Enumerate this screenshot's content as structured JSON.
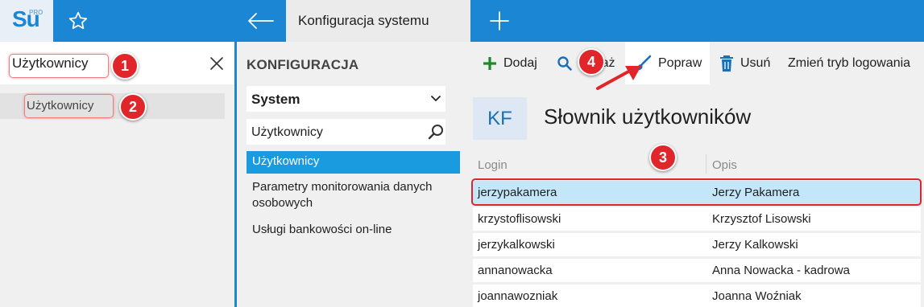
{
  "header": {
    "logo_text": "Su",
    "logo_sup": "PRO",
    "active_tab_title": "Konfiguracja systemu"
  },
  "left_search": {
    "query": "Użytkownicy",
    "results": [
      {
        "label": "Użytkownicy"
      }
    ]
  },
  "config": {
    "title": "KONFIGURACJA",
    "system_select": "System",
    "search_value": "Użytkownicy",
    "tree": [
      {
        "label": "Użytkownicy",
        "active": true
      },
      {
        "label": "Parametry monitorowania danych osobowych",
        "active": false
      },
      {
        "label": "Usługi bankowości on-line",
        "active": false
      }
    ]
  },
  "toolbar": {
    "add_label": "Dodaj",
    "show_label": "Pokaż",
    "edit_label": "Popraw",
    "delete_label": "Usuń",
    "login_mode_label": "Zmień tryb logowania"
  },
  "main": {
    "badge": "KF",
    "title": "Słownik użytkowników",
    "columns": [
      "Login",
      "Opis"
    ],
    "rows": [
      {
        "login": "jerzypakamera",
        "opis": "Jerzy Pakamera",
        "selected": true
      },
      {
        "login": "krzystoflisowski",
        "opis": "Krzysztof Lisowski",
        "selected": false
      },
      {
        "login": "jerzykalkowski",
        "opis": "Jerzy Kalkowski",
        "selected": false
      },
      {
        "login": "annanowacka",
        "opis": "Anna Nowacka - kadrowa",
        "selected": false
      },
      {
        "login": "joannawozniak",
        "opis": "Joanna Woźniak",
        "selected": false
      }
    ]
  },
  "annotations": {
    "step1": "1",
    "step2": "2",
    "step3": "3",
    "step4": "4"
  },
  "colors": {
    "brand_blue": "#1b86d4",
    "active_item": "#1a9be0",
    "selected_row": "#c3e6f8",
    "annotation_red": "#e0262a",
    "add_green": "#1e8a2e"
  }
}
